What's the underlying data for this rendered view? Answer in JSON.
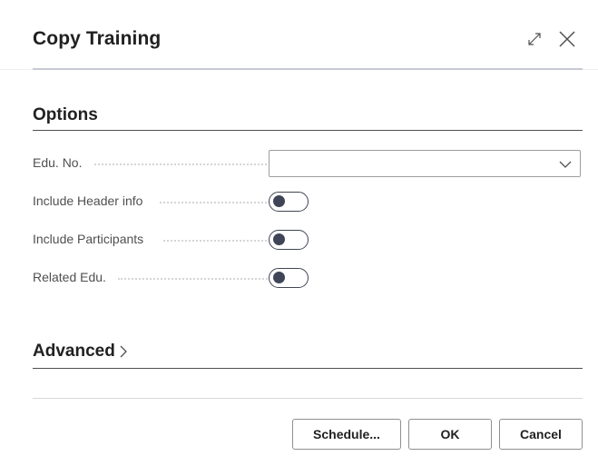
{
  "dialog": {
    "title": "Copy Training"
  },
  "icons": {
    "expand": "expand-icon",
    "close": "close-icon",
    "chevron": "chevron-down-icon",
    "advanced_chevron": "chevron-right-icon"
  },
  "options": {
    "title": "Options",
    "fields": [
      {
        "label": "Edu. No.",
        "type": "select",
        "value": ""
      },
      {
        "label": "Include Header info",
        "type": "toggle",
        "checked": false
      },
      {
        "label": "Include Participants",
        "type": "toggle",
        "checked": false
      },
      {
        "label": "Related Edu.",
        "type": "toggle",
        "checked": false
      }
    ]
  },
  "advanced": {
    "title": "Advanced"
  },
  "buttons": {
    "schedule": "Schedule...",
    "ok": "OK",
    "cancel": "Cancel"
  },
  "colors": {
    "text": "#212121",
    "label": "#505050",
    "toggle_off": "#3f4557",
    "border": "#8f8f8f"
  }
}
